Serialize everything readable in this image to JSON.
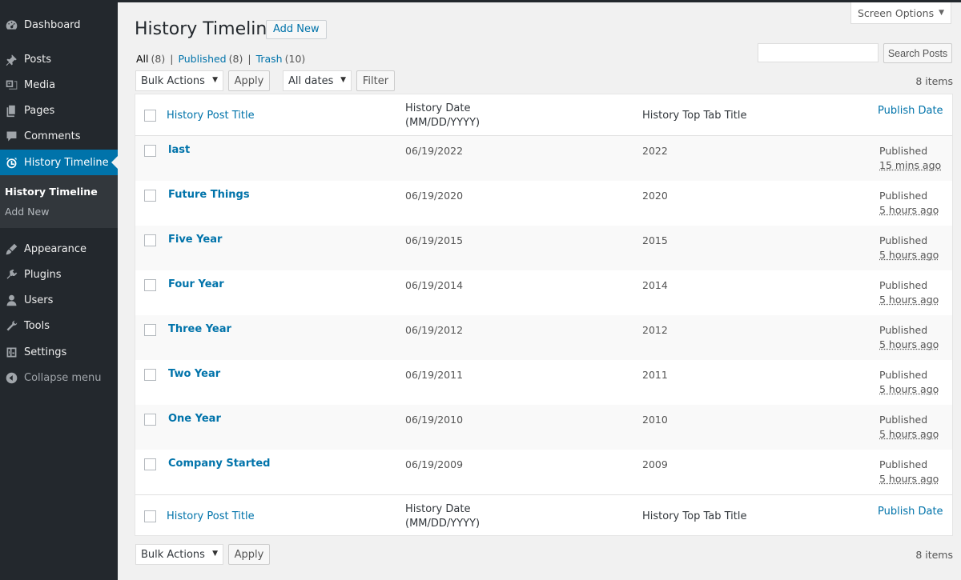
{
  "sidebar": {
    "items": [
      {
        "label": "Dashboard",
        "icon": "dashboard-icon"
      },
      {
        "label": "Posts",
        "icon": "pin-icon"
      },
      {
        "label": "Media",
        "icon": "media-icon"
      },
      {
        "label": "Pages",
        "icon": "pages-icon"
      },
      {
        "label": "Comments",
        "icon": "comment-icon"
      },
      {
        "label": "History Timeline",
        "icon": "clock-icon"
      },
      {
        "label": "Appearance",
        "icon": "brush-icon"
      },
      {
        "label": "Plugins",
        "icon": "plugin-icon"
      },
      {
        "label": "Users",
        "icon": "user-icon"
      },
      {
        "label": "Tools",
        "icon": "wrench-icon"
      },
      {
        "label": "Settings",
        "icon": "settings-icon"
      }
    ],
    "submenu": [
      "History Timeline",
      "Add New"
    ],
    "collapse_label": "Collapse menu"
  },
  "header": {
    "title": "History Timeline",
    "add_new": "Add New",
    "screen_options": "Screen Options"
  },
  "filters": {
    "all_label": "All",
    "all_count": "(8)",
    "published_label": "Published",
    "published_count": "(8)",
    "trash_label": "Trash",
    "trash_count": "(10)",
    "separator": "|"
  },
  "search": {
    "button": "Search Posts",
    "value": ""
  },
  "tablenav": {
    "bulk_actions": "Bulk Actions",
    "apply": "Apply",
    "all_dates": "All dates",
    "filter": "Filter",
    "items_count": "8 items"
  },
  "table": {
    "columns": {
      "title": "History Post Title",
      "date_line1": "History Date",
      "date_line2": "(MM/DD/YYYY)",
      "tab_title": "History Top Tab Title",
      "publish_date": "Publish Date"
    },
    "rows": [
      {
        "title": "last",
        "date": "06/19/2022",
        "tab": "2022",
        "status": "Published",
        "ago": "15 mins ago"
      },
      {
        "title": "Future Things",
        "date": "06/19/2020",
        "tab": "2020",
        "status": "Published",
        "ago": "5 hours ago"
      },
      {
        "title": "Five Year",
        "date": "06/19/2015",
        "tab": "2015",
        "status": "Published",
        "ago": "5 hours ago"
      },
      {
        "title": "Four Year",
        "date": "06/19/2014",
        "tab": "2014",
        "status": "Published",
        "ago": "5 hours ago"
      },
      {
        "title": "Three Year",
        "date": "06/19/2012",
        "tab": "2012",
        "status": "Published",
        "ago": "5 hours ago"
      },
      {
        "title": "Two Year",
        "date": "06/19/2011",
        "tab": "2011",
        "status": "Published",
        "ago": "5 hours ago"
      },
      {
        "title": "One Year",
        "date": "06/19/2010",
        "tab": "2010",
        "status": "Published",
        "ago": "5 hours ago"
      },
      {
        "title": "Company Started",
        "date": "06/19/2009",
        "tab": "2009",
        "status": "Published",
        "ago": "5 hours ago"
      }
    ]
  },
  "colors": {
    "sidebar_bg": "#23282d",
    "accent": "#0073aa",
    "page_bg": "#f1f1f1"
  }
}
